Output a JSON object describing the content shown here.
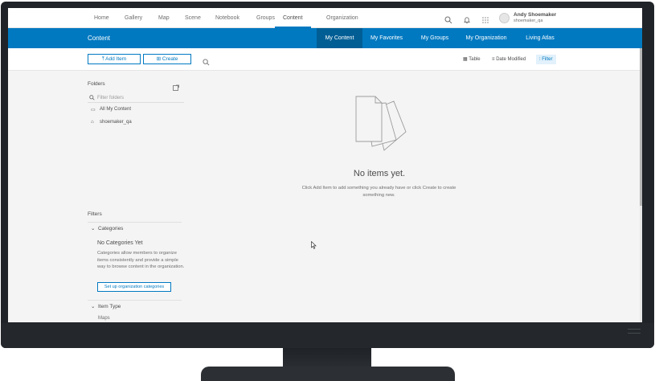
{
  "topnav": {
    "links": [
      "Home",
      "Gallery",
      "Map",
      "Scene",
      "Notebook",
      "Groups",
      "Content",
      "Organization"
    ],
    "active_index": 6,
    "user": {
      "name": "Andy Shoemaker",
      "handle": "shoemaker_qa"
    }
  },
  "header": {
    "title": "Content",
    "tabs": [
      "My Content",
      "My Favorites",
      "My Groups",
      "My Organization",
      "Living Atlas"
    ],
    "active_tab_index": 0
  },
  "toolbar": {
    "add_item_label": "Add Item",
    "create_label": "Create",
    "table_label": "Table",
    "sort_label": "Date Modified",
    "filter_label": "Filter"
  },
  "folders": {
    "heading": "Folders",
    "filter_placeholder": "Filter folders",
    "items": [
      "All My Content",
      "shoemaker_qa"
    ]
  },
  "filters": {
    "heading": "Filters",
    "categories_label": "Categories",
    "no_categories_title": "No Categories Yet",
    "no_categories_desc": "Categories allow members to organize items consistently and provide a simple way to browse content in the organization.",
    "setup_button_label": "Set up organization categories",
    "item_type_label": "Item Type",
    "item_type_first": "Maps"
  },
  "empty_state": {
    "title": "No items yet.",
    "description": "Click Add Item to add something you already have or click Create to create something new."
  },
  "colors": {
    "brand_blue": "#0079c1",
    "active_tab": "#005e95",
    "bezel": "#202428"
  }
}
